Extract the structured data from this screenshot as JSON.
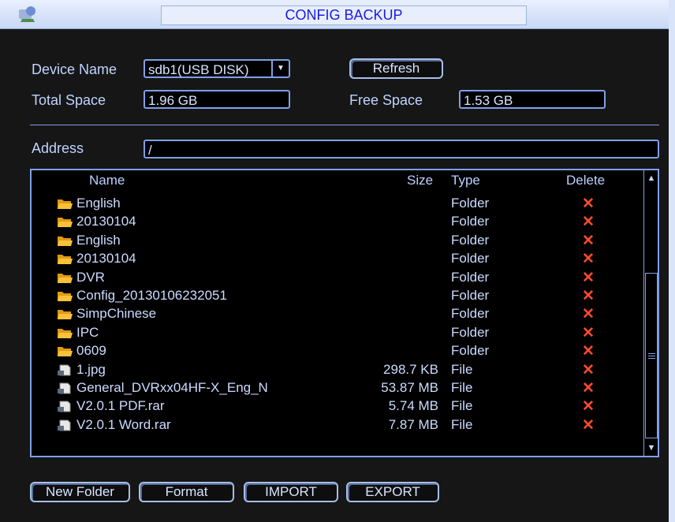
{
  "window": {
    "title": "CONFIG BACKUP"
  },
  "device": {
    "name_label": "Device Name",
    "name_value": "sdb1(USB DISK)",
    "refresh_label": "Refresh",
    "total_label": "Total Space",
    "total_value": "1.96 GB",
    "free_label": "Free Space",
    "free_value": "1.53 GB"
  },
  "address": {
    "label": "Address",
    "value": "/"
  },
  "list": {
    "headers": {
      "name": "Name",
      "size": "Size",
      "type": "Type",
      "delete": "Delete"
    },
    "rows": [
      {
        "name": "English",
        "size": "",
        "type": "Folder",
        "icon": "folder-icon"
      },
      {
        "name": "20130104",
        "size": "",
        "type": "Folder",
        "icon": "folder-icon"
      },
      {
        "name": "English",
        "size": "",
        "type": "Folder",
        "icon": "folder-icon"
      },
      {
        "name": "20130104",
        "size": "",
        "type": "Folder",
        "icon": "folder-icon"
      },
      {
        "name": "DVR",
        "size": "",
        "type": "Folder",
        "icon": "folder-icon"
      },
      {
        "name": "Config_20130106232051",
        "size": "",
        "type": "Folder",
        "icon": "folder-icon"
      },
      {
        "name": "SimpChinese",
        "size": "",
        "type": "Folder",
        "icon": "folder-icon"
      },
      {
        "name": "IPC",
        "size": "",
        "type": "Folder",
        "icon": "folder-icon"
      },
      {
        "name": "0609",
        "size": "",
        "type": "Folder",
        "icon": "folder-icon"
      },
      {
        "name": "1.jpg",
        "size": "298.7 KB",
        "type": "File",
        "icon": "file-icon"
      },
      {
        "name": "General_DVRxx04HF-X_Eng_N",
        "size": "53.87 MB",
        "type": "File",
        "icon": "file-icon"
      },
      {
        "name": "V2.0.1 PDF.rar",
        "size": "5.74 MB",
        "type": "File",
        "icon": "file-icon"
      },
      {
        "name": "V2.0.1 Word.rar",
        "size": "7.87 MB",
        "type": "File",
        "icon": "file-icon"
      }
    ],
    "delete_glyph": "✕"
  },
  "buttons": {
    "new_folder": "New Folder",
    "format": "Format",
    "import": "IMPORT",
    "export": "EXPORT"
  },
  "colors": {
    "accent": "#7ea0e8",
    "delete": "#ff4b2e",
    "title_text": "#1a1ae6",
    "background": "#161616"
  }
}
